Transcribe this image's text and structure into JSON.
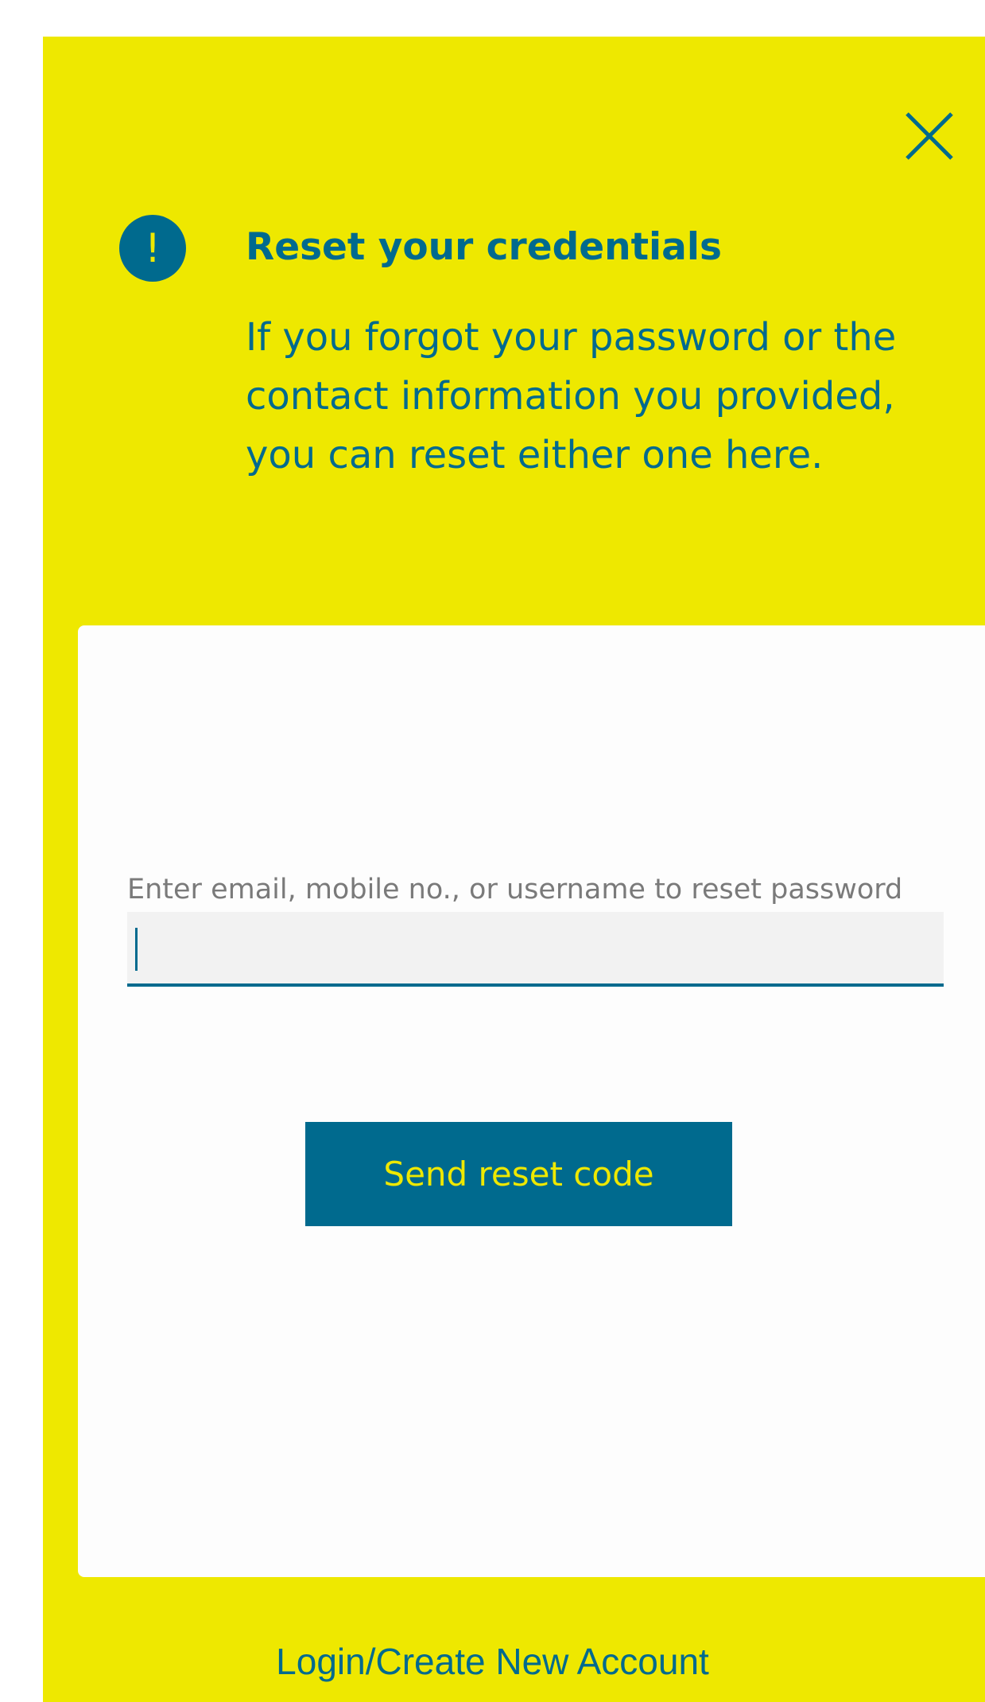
{
  "colors": {
    "panel_background": "#eee800",
    "accent": "#006a8e",
    "card_background": "#fdfdfd",
    "input_background": "#f2f2f2",
    "label_text": "#7a7a7a"
  },
  "header": {
    "close_icon": "close-icon",
    "alert_icon": "exclamation-circle-icon",
    "alert_glyph": "!",
    "title": "Reset your credentials",
    "description": "If you forgot your password or the contact information you provided, you can reset either one here."
  },
  "form": {
    "field_label": "Enter email, mobile no., or username to reset password",
    "field_value": "",
    "submit_label": "Send reset code"
  },
  "footer": {
    "login_link": "Login/Create New Account"
  }
}
